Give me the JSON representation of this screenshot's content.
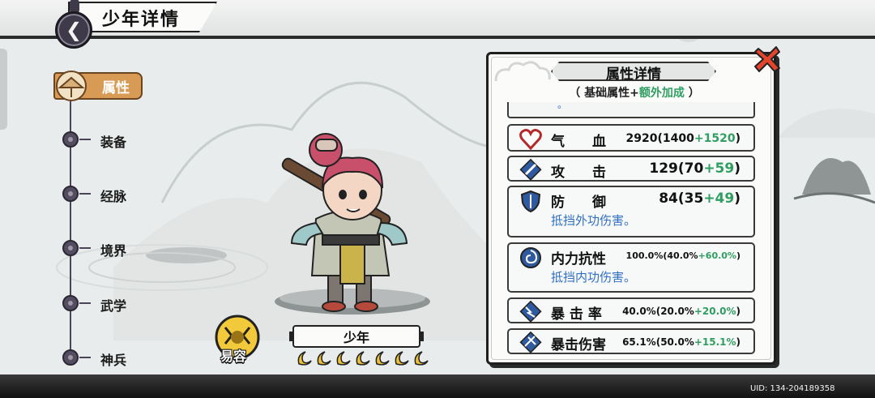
{
  "header": {
    "title": "少年详情"
  },
  "sidebar": {
    "items": [
      {
        "label": "属性",
        "active": true
      },
      {
        "label": "装备",
        "active": false
      },
      {
        "label": "经脉",
        "active": false
      },
      {
        "label": "境界",
        "active": false
      },
      {
        "label": "武学",
        "active": false
      },
      {
        "label": "神兵",
        "active": false
      }
    ]
  },
  "character": {
    "name": "少年",
    "badge_label": "易容",
    "star_count": 7
  },
  "panel": {
    "title": "属性详情",
    "subtitle_open": "（ 基础属性+",
    "subtitle_extra": "额外加成",
    "subtitle_close": " ）",
    "cut_text": "。",
    "stats": [
      {
        "icon": "heart-icon",
        "name": "气　　血",
        "total": "2920",
        "base": "1400",
        "bonus": "+1520",
        "desc": ""
      },
      {
        "icon": "sword-icon",
        "name": "攻　　击",
        "total": "129",
        "base": "70",
        "bonus": "+59",
        "desc": ""
      },
      {
        "icon": "shield-icon",
        "name": "防　　御",
        "total": "84",
        "base": "35",
        "bonus": "+49",
        "desc": "抵挡外功伤害。"
      },
      {
        "icon": "swirl-icon",
        "name": "内力抗性",
        "total": "100.0%",
        "base": "40.0%",
        "bonus": "+60.0%",
        "desc": "抵挡内功伤害。"
      },
      {
        "icon": "crit-icon",
        "name": "暴 击 率",
        "total": "40.0%",
        "base": "20.0%",
        "bonus": "+20.0%",
        "desc": ""
      },
      {
        "icon": "crit-damage-icon",
        "name": "暴击伤害",
        "total": "65.1%",
        "base": "50.0%",
        "bonus": "+15.1%",
        "desc": ""
      }
    ]
  },
  "footer": {
    "uid": "UID: 134-204189358"
  },
  "colors": {
    "accent_orange": "#d79b55",
    "bonus_green": "#2f9e60",
    "desc_blue": "#2f6fc4",
    "dark": "#1e1e1e"
  }
}
